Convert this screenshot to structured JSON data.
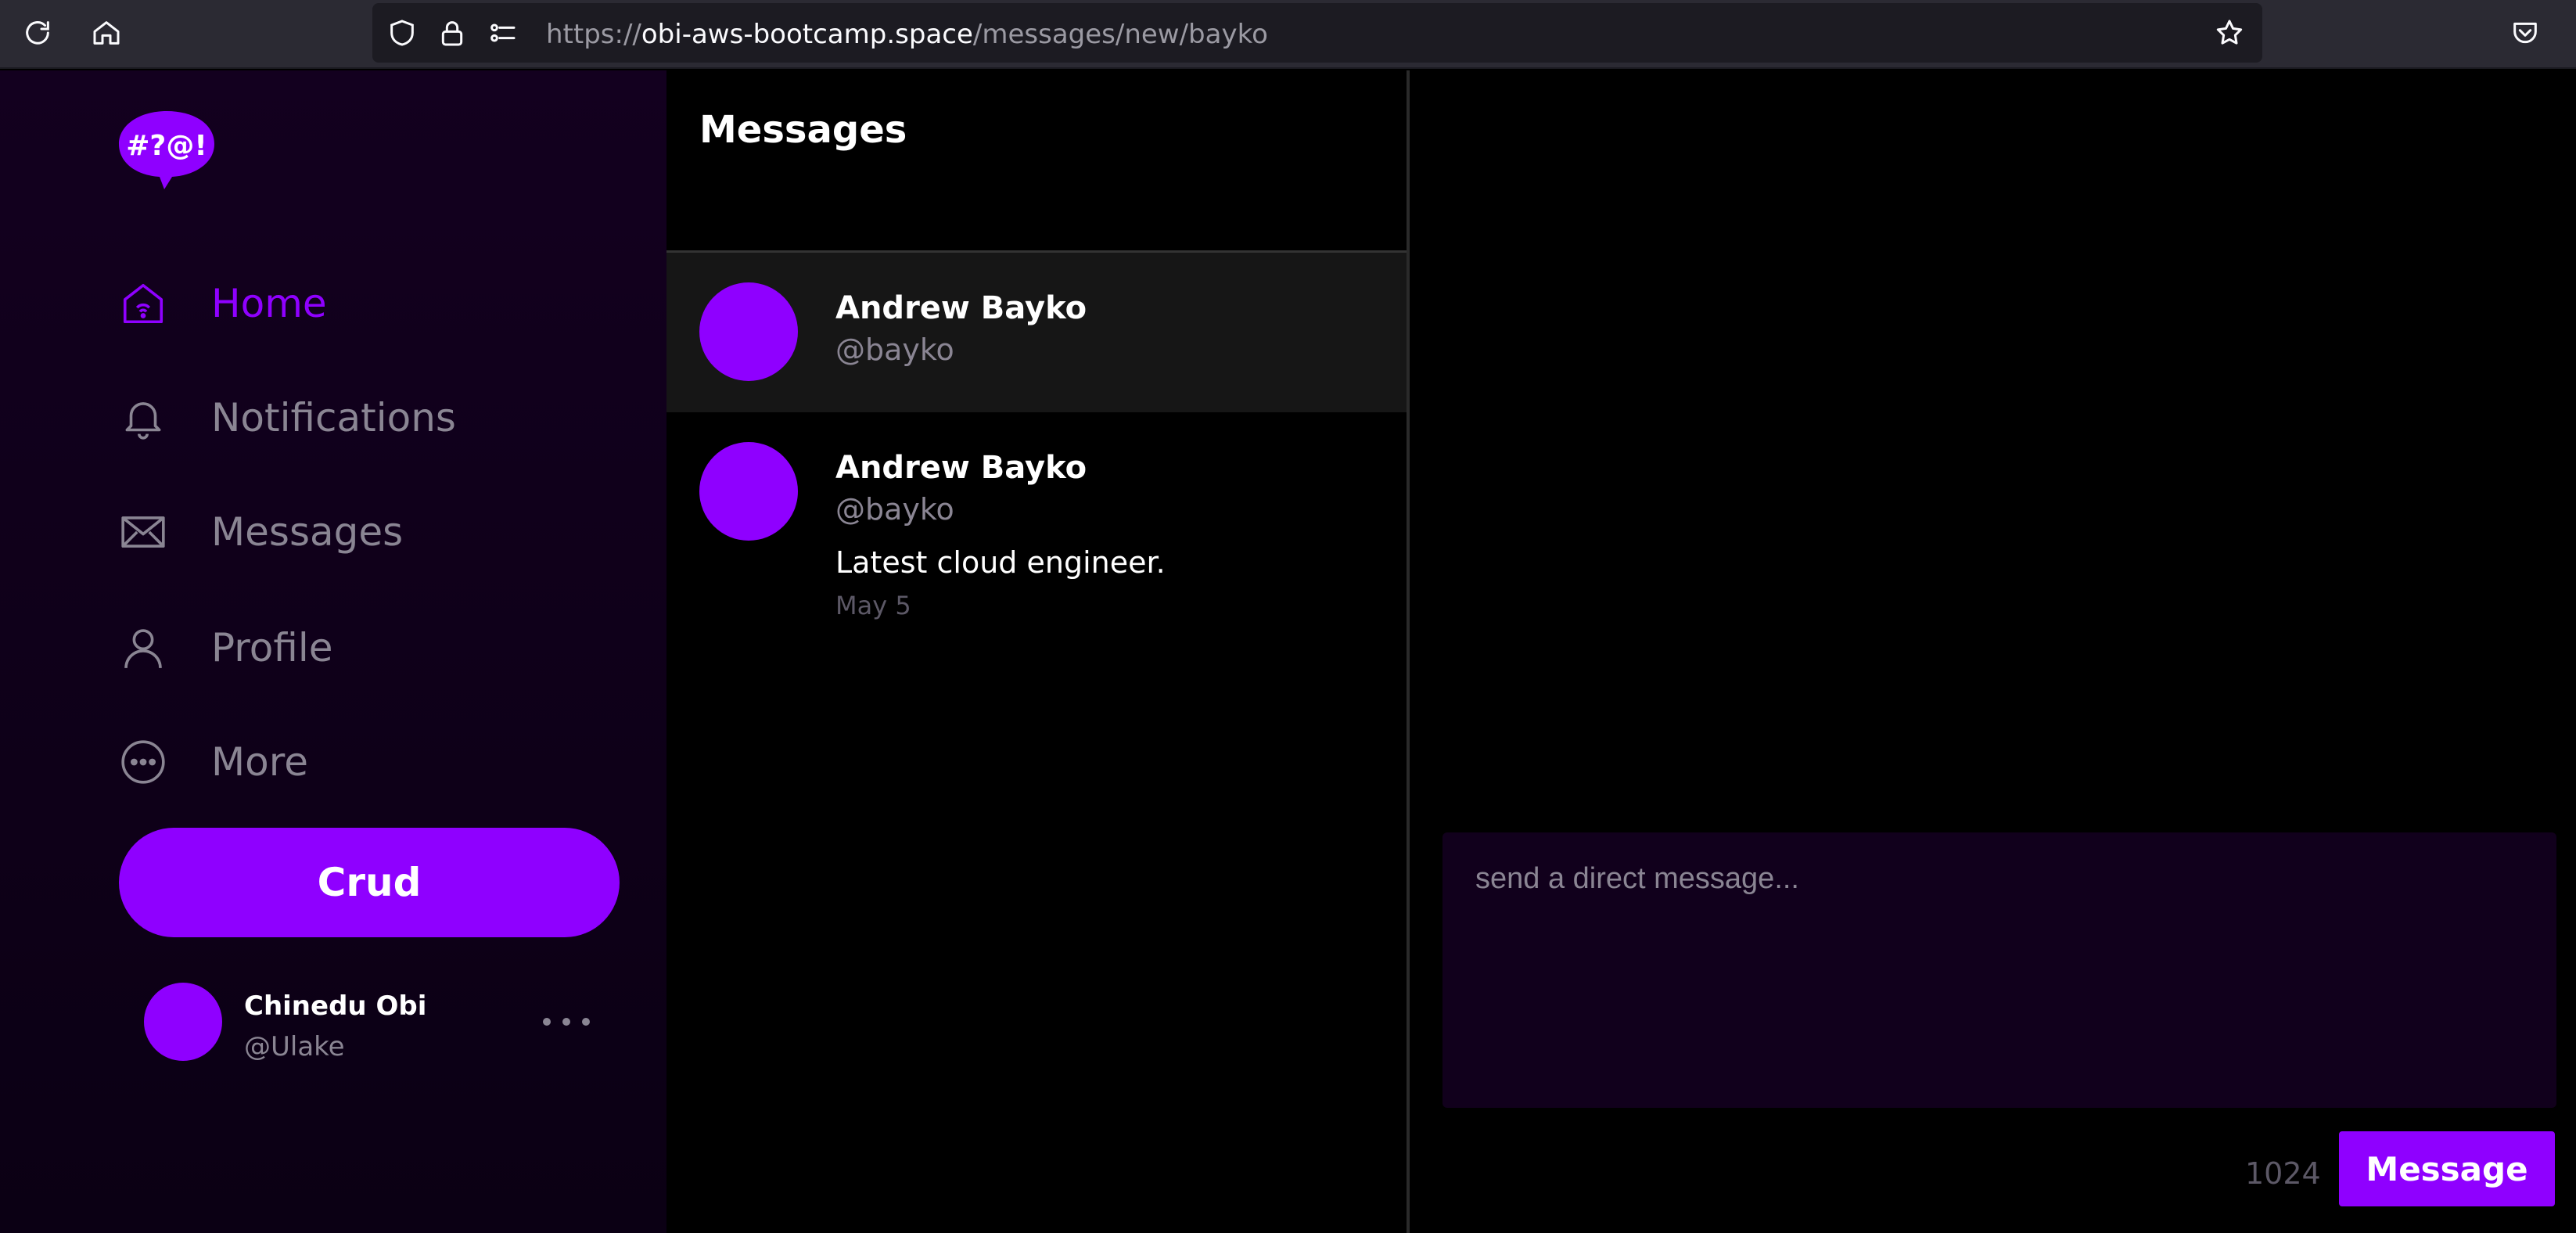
{
  "browser": {
    "url_prefix": "https://",
    "url_host": "obi-aws-bootcamp.space",
    "url_path": "/messages/new/bayko",
    "icons": [
      "reload-icon",
      "home-icon",
      "shield-icon",
      "lock-icon",
      "permissions-icon",
      "bookmark-star-icon",
      "pocket-icon"
    ]
  },
  "sidebar": {
    "logo_text": "#?@!",
    "items": [
      {
        "label": "Home",
        "icon": "home-icon",
        "active": true
      },
      {
        "label": "Notifications",
        "icon": "bell-icon",
        "active": false
      },
      {
        "label": "Messages",
        "icon": "envelope-icon",
        "active": false
      },
      {
        "label": "Profile",
        "icon": "user-icon",
        "active": false
      },
      {
        "label": "More",
        "icon": "ellipsis-circle-icon",
        "active": false
      }
    ],
    "crud_label": "Crud",
    "user": {
      "name": "Chinedu Obi",
      "handle": "@Ulake"
    }
  },
  "messages": {
    "title": "Messages",
    "conversations": [
      {
        "name": "Andrew Bayko",
        "handle": "@bayko",
        "selected": true
      },
      {
        "name": "Andrew Bayko",
        "handle": "@bayko",
        "preview": "Latest cloud engineer.",
        "date": "May 5",
        "selected": false
      }
    ]
  },
  "compose": {
    "placeholder": "send a direct message...",
    "value": "",
    "count": "1024",
    "send_label": "Message"
  },
  "colors": {
    "accent": "#8f00ff",
    "muted": "#8a8593",
    "sidebar_bg": "#13001f",
    "compose_bg": "#11001c"
  }
}
